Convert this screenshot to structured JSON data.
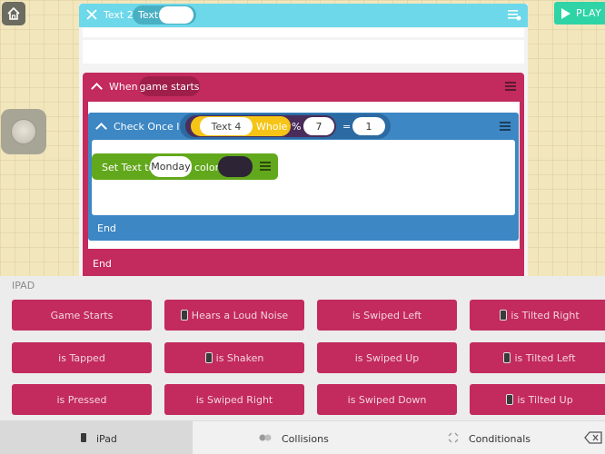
{
  "object_panel": {
    "title": "Text 2",
    "trait_label": "Text"
  },
  "when_block": {
    "label": "When",
    "event": "game starts",
    "end_label": "End"
  },
  "check_block": {
    "label": "Check Once If",
    "operand": "Text 4",
    "function": "Whole",
    "operator": "%",
    "modulus": "7",
    "comparator": "=",
    "compare_value": "1",
    "end_label": "End"
  },
  "set_block": {
    "label": "Set Text to",
    "value": "Monday",
    "color_label": "color"
  },
  "play_button": {
    "label": "PLAY"
  },
  "rules_panel": {
    "section_label": "IPAD",
    "rules": [
      [
        "Game Starts",
        "Hears a Loud Noise",
        "is Swiped Left",
        "is Tilted Right"
      ],
      [
        "is Tapped",
        "is Shaken",
        "is Swiped Up",
        "is Tilted Left"
      ],
      [
        "is Pressed",
        "is Swiped Right",
        "is Swiped Down",
        "is Tilted Up"
      ]
    ]
  },
  "tabs": {
    "ipad": "iPad",
    "collisions": "Collisions",
    "conditionals": "Conditionals"
  },
  "colors": {
    "header": "#6cd8ea",
    "rule": "#c32a5d",
    "check": "#3d87c4",
    "set": "#62a81c",
    "play": "#2ed4a6"
  }
}
